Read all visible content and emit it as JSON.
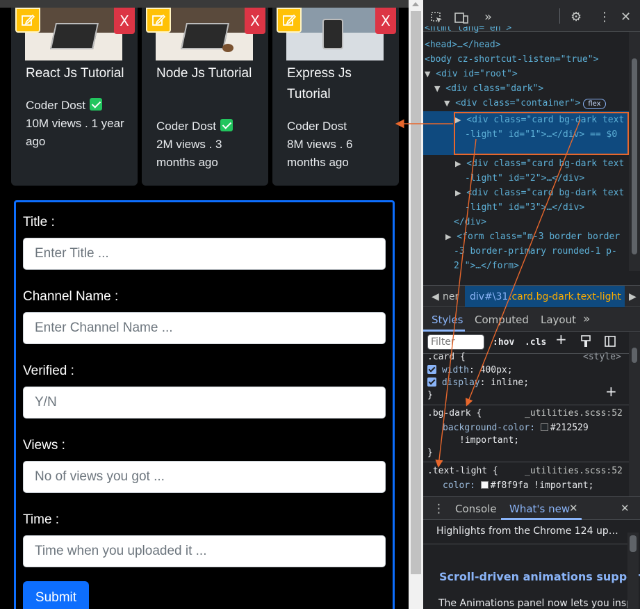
{
  "cards": [
    {
      "title": "React Js Tutorial",
      "channel": "Coder Dost",
      "verified": true,
      "meta": "10M views . 1 year ago",
      "edit_icon": "edit-icon",
      "delete_label": "X"
    },
    {
      "title": "Node Js Tutorial",
      "channel": "Coder Dost",
      "verified": true,
      "meta": "2M views . 3 months ago",
      "edit_icon": "edit-icon",
      "delete_label": "X"
    },
    {
      "title": "Express Js Tutorial",
      "channel": "Coder Dost",
      "verified": false,
      "meta": "8M views . 6 months ago",
      "edit_icon": "edit-icon",
      "delete_label": "X"
    }
  ],
  "form": {
    "fields": [
      {
        "label": "Title :",
        "placeholder": "Enter Title ..."
      },
      {
        "label": "Channel Name :",
        "placeholder": "Enter Channel Name ..."
      },
      {
        "label": "Verified :",
        "placeholder": "Y/N"
      },
      {
        "label": "Views :",
        "placeholder": "No of views you got ..."
      },
      {
        "label": "Time :",
        "placeholder": "Time when you uploaded it ..."
      }
    ],
    "submit_label": "Submit"
  },
  "devtools": {
    "elements_lines": [
      "<head>…</head>",
      "<body cz-shortcut-listen=\"true\">",
      "<div id=\"root\">",
      "<div class=\"dark\">",
      "<div class=\"container\">",
      "flex",
      "<div class=\"card bg-dark text",
      "-light\" id=\"1\">…</div> == $0",
      "<div class=\"card bg-dark text",
      "-light\" id=\"2\">…</div>",
      "<div class=\"card bg-dark text",
      "-light\" id=\"3\">…</div>",
      "</div>",
      "<form class=\"m-3 border border",
      "-3 border-primary rounded-1 p-",
      "2 \">…</form>"
    ],
    "breadcrumb": {
      "left": "ner",
      "active_prefix": "div#\\31",
      "active_suffix": ".card.bg-dark.text-light"
    },
    "style_tabs": [
      "Styles",
      "Computed",
      "Layout"
    ],
    "filter_placeholder": "Filter",
    "hov_label": ":hov",
    "cls_label": ".cls",
    "rules": {
      "card": {
        "selector": ".card {",
        "source": "<style>",
        "width": "400px;",
        "display": "inline;"
      },
      "bgdark": {
        "selector": ".bg-dark {",
        "source": "_utilities.scss:52",
        "prop": "background-color:",
        "value": "#212529",
        "important": "!important;"
      },
      "textlight": {
        "selector": ".text-light {",
        "source": "_utilities.scss:52",
        "prop": "color:",
        "value": "#f8f9fa !important;"
      }
    },
    "drawer_tabs": [
      "Console",
      "What's new"
    ],
    "drawer_heading": "Highlights from the Chrome 124 up…",
    "drawer_title": "Scroll-driven animations suppor",
    "drawer_text": "The Animations panel now lets you inspe"
  },
  "colors": {
    "card_bg": "#212529",
    "text_light": "#f8f9fa",
    "primary": "#0d6efd",
    "warning": "#ffc107",
    "danger": "#dc3545",
    "highlight": "#e8672c"
  }
}
